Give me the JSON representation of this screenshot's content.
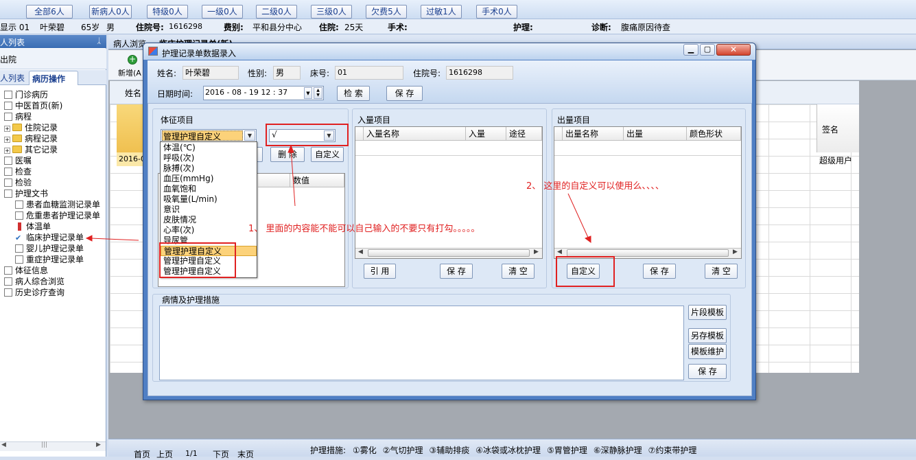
{
  "filter_buttons": [
    "全部6人",
    "新病人0人",
    "特级0人",
    "一级0人",
    "二级0人",
    "三级0人",
    "欠费5人",
    "过敏1人",
    "手术0人"
  ],
  "patient_bar": {
    "display_prefix": "显示 01",
    "name": "叶荣碧",
    "age": "65岁",
    "sex": "男",
    "admit_label": "住院号:",
    "admit_no": "1616298",
    "dept_label": "费别:",
    "dept": "平和县分中心",
    "stay_label": "住院:",
    "stay": "25天",
    "surgery_label": "手术:",
    "nursing_label": "护理:",
    "diag_label": "诊断:",
    "diagnosis": "腹痛原因待查"
  },
  "left_panel": {
    "title": "人列表",
    "pin": "ᛣ",
    "discharge": "出院",
    "tab_list": "人列表",
    "tab_ops": "病历操作"
  },
  "tree": [
    {
      "label": "门诊病历",
      "level": 0,
      "icon": "doc"
    },
    {
      "label": "中医首页(新)",
      "level": 0,
      "icon": "doc"
    },
    {
      "label": "病程",
      "level": 0,
      "icon": "doc"
    },
    {
      "label": "住院记录",
      "level": 1,
      "icon": "folder"
    },
    {
      "label": "病程记录",
      "level": 1,
      "icon": "folder"
    },
    {
      "label": "其它记录",
      "level": 1,
      "icon": "folder"
    },
    {
      "label": "医嘱",
      "level": 0,
      "icon": "doc"
    },
    {
      "label": "检查",
      "level": 0,
      "icon": "doc"
    },
    {
      "label": "检验",
      "level": 0,
      "icon": "doc"
    },
    {
      "label": "护理文书",
      "level": 0,
      "icon": "doc"
    },
    {
      "label": "患者血糖监测记录单",
      "level": 2,
      "icon": "doc"
    },
    {
      "label": "危重患者护理记录单",
      "level": 2,
      "icon": "doc"
    },
    {
      "label": "体温单",
      "level": 2,
      "icon": "therm"
    },
    {
      "label": "临床护理记录单",
      "level": 2,
      "icon": "check"
    },
    {
      "label": "婴儿护理记录单",
      "level": 2,
      "icon": "doc"
    },
    {
      "label": "重症护理记录单",
      "level": 2,
      "icon": "doc"
    },
    {
      "label": "体征信息",
      "level": 0,
      "icon": "doc"
    },
    {
      "label": "病人综合浏览",
      "level": 0,
      "icon": "doc"
    },
    {
      "label": "历史诊疗查询",
      "level": 0,
      "icon": "doc"
    }
  ],
  "main_tabs": [
    "病人浏览",
    "临床护理记录单(新)"
  ],
  "toolbar": {
    "add": "新增(A"
  },
  "bg_grid": {
    "col_name": "姓名",
    "col_sign": "签名",
    "row_date": "2016-0",
    "row_sign": "超级用户"
  },
  "bottom_bar": {
    "first": "首页",
    "prev": "上页",
    "page": "1/1",
    "next": "下页",
    "last": "末页",
    "measures_label": "护理措施:",
    "measures": [
      "①雾化",
      "②气切护理",
      "③辅助排痰",
      "④冰袋或冰枕护理",
      "⑤胃管护理",
      "⑥深静脉护理",
      "⑦约束带护理"
    ]
  },
  "dialog": {
    "title": "护理记录单数据录入",
    "name_label": "姓名:",
    "name": "叶荣碧",
    "sex_label": "性别:",
    "sex": "男",
    "bed_label": "床号:",
    "bed": "01",
    "admit_label": "住院号:",
    "admit": "1616298",
    "date_label": "日期时间:",
    "date": "2016 - 08 - 19   12 : 37",
    "search": "检 索",
    "save": "保 存",
    "vitals": {
      "title": "体征项目",
      "combo_value": "管理护理自定义",
      "value_combo": "√",
      "delete": "删 除",
      "custom": "自定义",
      "col_value": "数值",
      "dropdown": [
        "体温(℃)",
        "呼吸(次)",
        "脉搏(次)",
        "血压(mmHg)",
        "血氧饱和",
        "吸氧量(L/min)",
        "意识",
        "皮肤情况",
        "心率(次)",
        "导尿管",
        "管理护理自定义",
        "管理护理自定义",
        "管理护理自定义"
      ]
    },
    "intake": {
      "title": "入量项目",
      "cols": [
        "入量名称",
        "入量",
        "途径"
      ],
      "quote": "引 用",
      "save": "保 存",
      "clear": "清 空"
    },
    "output": {
      "title": "出量项目",
      "cols": [
        "出量名称",
        "出量",
        "颜色形状"
      ],
      "custom": "自定义",
      "save": "保 存",
      "clear": "清 空"
    },
    "measures": {
      "title": "病情及护理措施",
      "seg_template": "片段模板",
      "save_template": "另存模板",
      "maintain": "模板维护",
      "save": "保 存"
    }
  },
  "annotations": {
    "note1": "1、  里面的内容能不能可以自己输入的不要只有打勾。。。。。",
    "note2": "2、    这里的自定义可以使用么、、、、"
  },
  "colors": {
    "annotation": "#e02020",
    "dialog_blue": "#4f7fc4",
    "panel": "#d8e4f4"
  }
}
